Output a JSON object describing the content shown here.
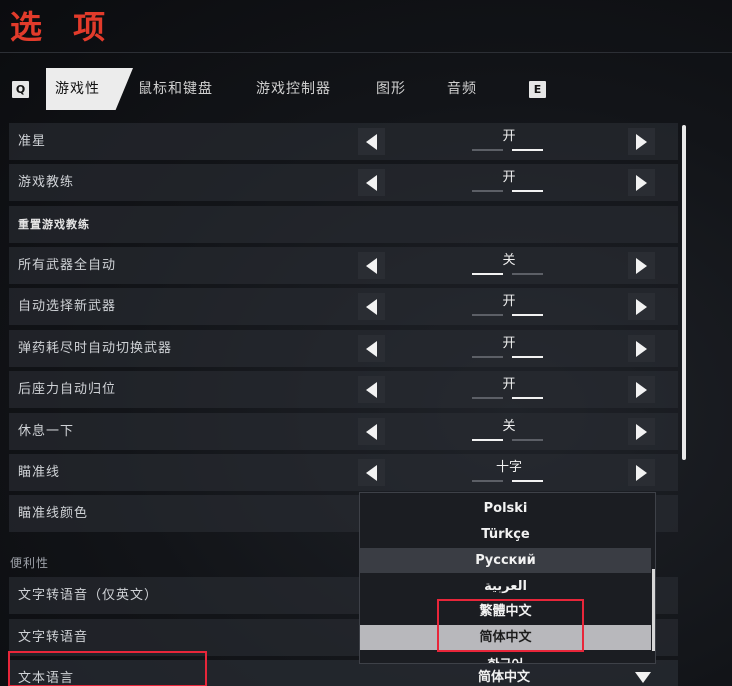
{
  "page_title": "选 项",
  "tabs": {
    "prev_key": "Q",
    "next_key": "E",
    "items": [
      {
        "label": "游戏性",
        "active": true
      },
      {
        "label": "鼠标和键盘",
        "active": false
      },
      {
        "label": "游戏控制器",
        "active": false
      },
      {
        "label": "图形",
        "active": false
      },
      {
        "label": "音频",
        "active": false
      }
    ]
  },
  "settings": [
    {
      "label": "准星",
      "value": "开",
      "state": "on"
    },
    {
      "label": "游戏教练",
      "value": "开",
      "state": "on"
    },
    {
      "label": "重置游戏教练"
    },
    {
      "label": "所有武器全自动",
      "value": "关",
      "state": "off"
    },
    {
      "label": "自动选择新武器",
      "value": "开",
      "state": "on"
    },
    {
      "label": "弹药耗尽时自动切换武器",
      "value": "开",
      "state": "on"
    },
    {
      "label": "后座力自动归位",
      "value": "开",
      "state": "on"
    },
    {
      "label": "休息一下",
      "value": "关",
      "state": "off"
    },
    {
      "label": "瞄准线",
      "value": "十字",
      "state": "on"
    },
    {
      "label": "瞄准线颜色"
    }
  ],
  "section_label": "便利性",
  "convenience": [
    {
      "label": "文字转语音（仅英文）"
    },
    {
      "label": "文字转语音"
    }
  ],
  "language": {
    "label": "文本语言",
    "value": "简体中文",
    "options": [
      "Polski",
      "Türkçe",
      "Русский",
      "العربية",
      "繁體中文",
      "简体中文",
      "한국어"
    ],
    "hovered": "Русский",
    "selected": "简体中文"
  },
  "colors": {
    "accent": "#e23b2b",
    "highlight": "#e8263a"
  }
}
